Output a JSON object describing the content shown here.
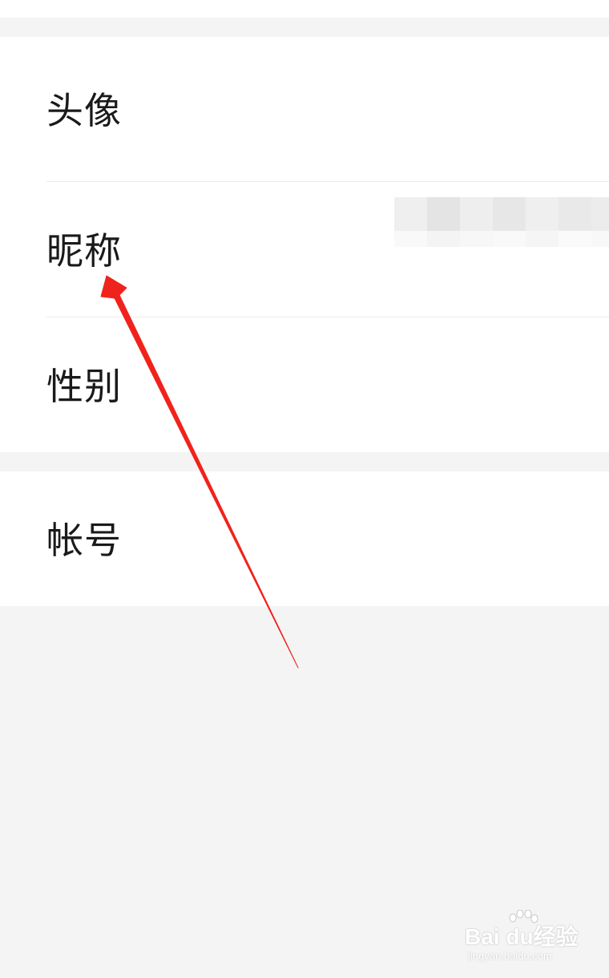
{
  "settings": {
    "items": [
      {
        "label": "头像"
      },
      {
        "label": "昵称",
        "value": ""
      },
      {
        "label": "性别"
      },
      {
        "label": "帐号"
      }
    ]
  },
  "annotation": {
    "arrow_color": "#f0231c",
    "arrow_target": "昵称"
  },
  "watermark": {
    "brand": "Bai  du经验",
    "url": "jingyan.baidu.com"
  },
  "colors": {
    "background": "#f4f4f4",
    "card": "#ffffff",
    "text": "#1a1a1a",
    "divider": "#ebebeb"
  }
}
